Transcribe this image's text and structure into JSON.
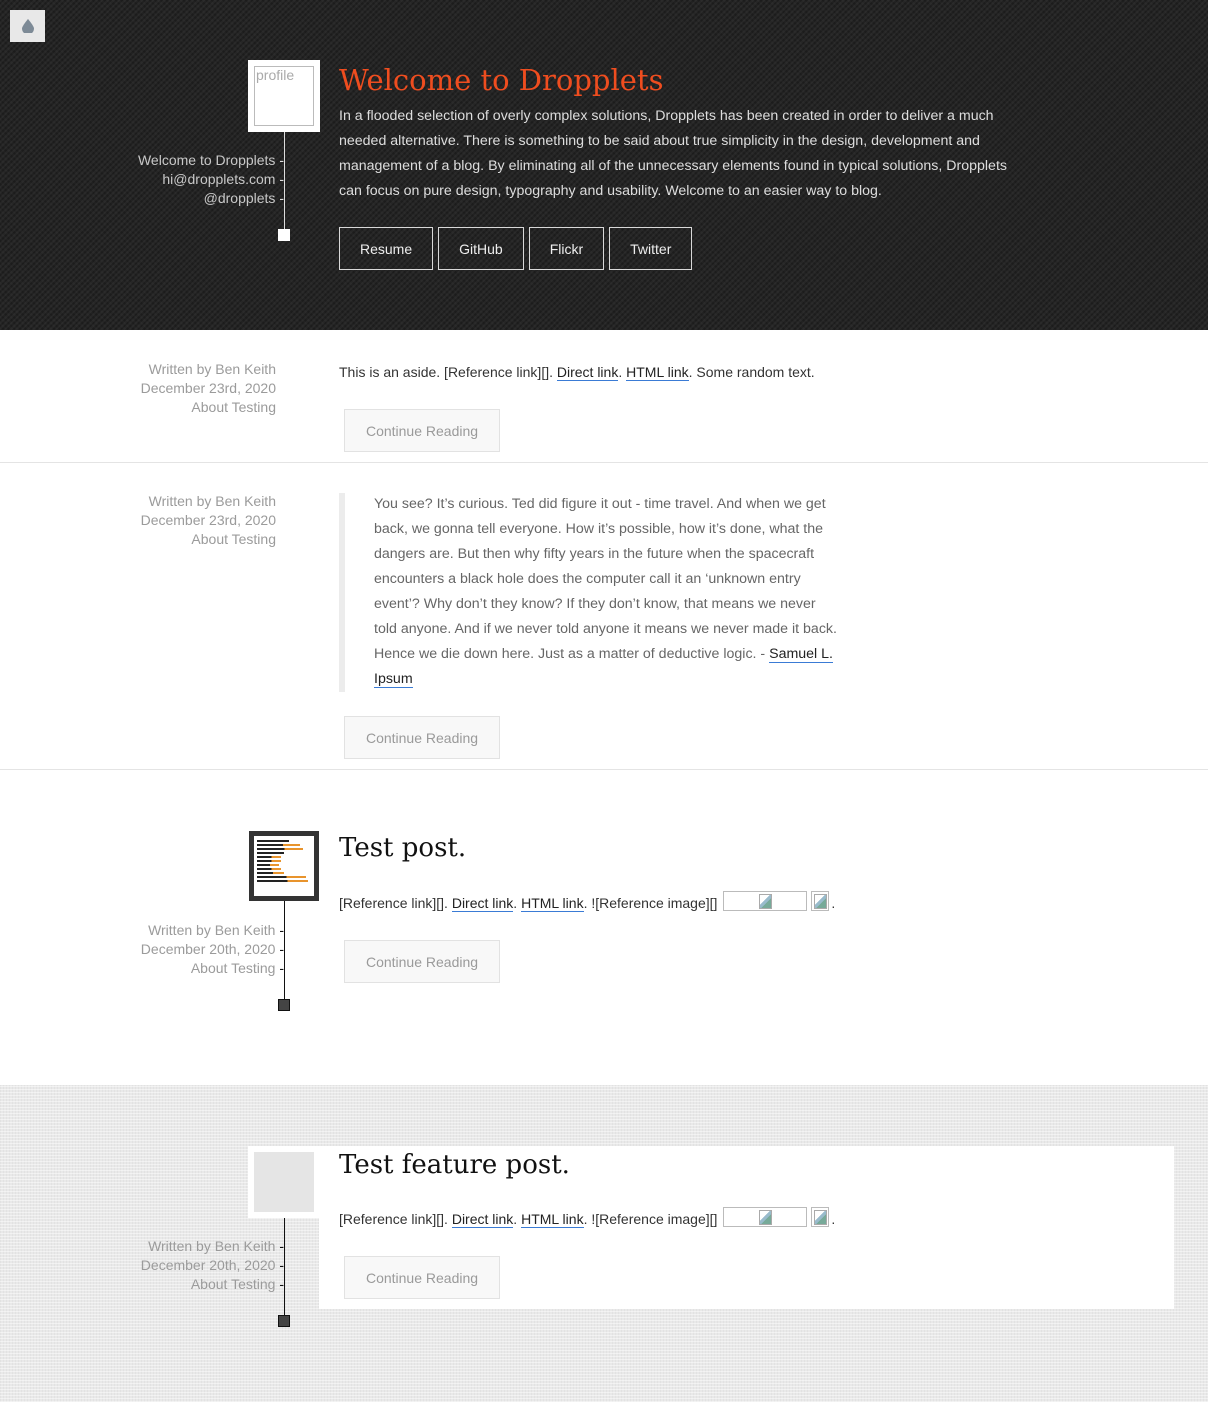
{
  "header": {
    "profile_alt": "profile",
    "meta": [
      "Welcome to Dropplets",
      "hi@dropplets.com",
      "@dropplets"
    ],
    "title": "Welcome to Dropplets",
    "intro": "In a flooded selection of overly complex solutions, Dropplets has been created in order to deliver a much needed alternative. There is something to be said about true simplicity in the design, development and management of a blog. By eliminating all of the unnecessary elements found in typical solutions, Dropplets can focus on pure design, typography and usability. Welcome to an easier way to blog.",
    "buttons": [
      "Resume",
      "GitHub",
      "Flickr",
      "Twitter"
    ]
  },
  "colors": {
    "accent": "#ef4d1f",
    "header_bg": "#262626",
    "link_underline": "#3a7bd5"
  },
  "continue_label": "Continue Reading",
  "posts": [
    {
      "meta": [
        "Written by Ben Keith",
        "December 23rd, 2020",
        "About Testing"
      ],
      "text_before": "This is an aside. [Reference link][]. ",
      "link1": "Direct link",
      "sep": ". ",
      "link2": "HTML link",
      "text_after": ". Some random text."
    },
    {
      "meta": [
        "Written by Ben Keith",
        "December 23rd, 2020",
        "About Testing"
      ],
      "quote": "You see? It’s curious. Ted did figure it out - time travel. And when we get back, we gonna tell everyone. How it’s possible, how it’s done, what the dangers are. But then why fifty years in the future when the spacecraft encounters a black hole does the computer call it an ‘unknown entry event’? Why don’t they know? If they don’t know, that means we never told anyone. And if we never told anyone it means we never made it back. Hence we die down here. Just as a matter of deductive logic. -",
      "quote_author": "Samuel L. Ipsum"
    },
    {
      "meta": [
        "Written by Ben Keith",
        "December 20th, 2020",
        "About Testing"
      ],
      "title": "Test post.",
      "text_before": "[Reference link][]. ",
      "link1": "Direct link",
      "sep": ". ",
      "link2": "HTML link",
      "text_mid": ". ![Reference image][] ",
      "text_end": "."
    },
    {
      "meta": [
        "Written by Ben Keith",
        "December 20th, 2020",
        "About Testing"
      ],
      "title": "Test feature post.",
      "text_before": "[Reference link][]. ",
      "link1": "Direct link",
      "sep": ". ",
      "link2": "HTML link",
      "text_mid": ". ![Reference image][] ",
      "text_end": "."
    }
  ]
}
